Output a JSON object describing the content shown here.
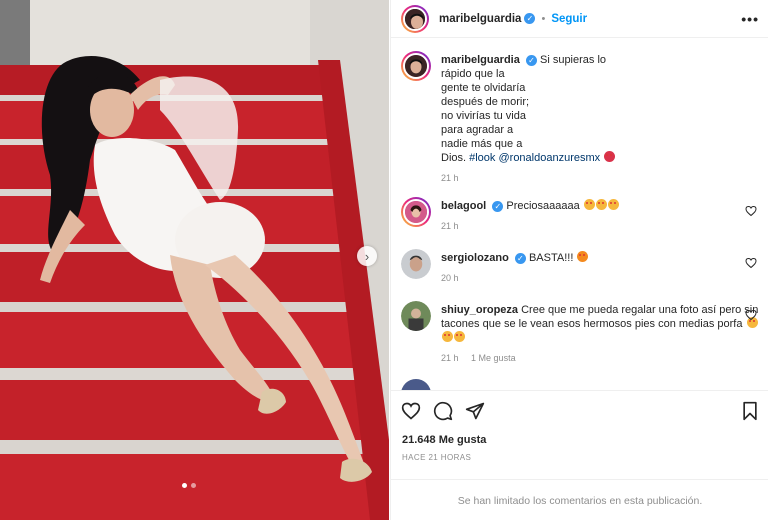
{
  "header": {
    "username": "maribelguardia",
    "follow_label": "Seguir",
    "separator": "•",
    "more_label": "•••"
  },
  "caption": {
    "username": "maribelguardia",
    "line1": "Si supieras lo",
    "line2": "rápido que la",
    "line3": "gente te olvidaría",
    "line4": "después de morir;",
    "line5": "no vivirías tu vida",
    "line6": "para agradar a",
    "line7": "nadie más que a",
    "line8": "Dios.",
    "hashtag": "#look",
    "mention": "@ronaldoanzuresmx",
    "time": "21 h"
  },
  "comments": [
    {
      "username": "belagool",
      "text": "Preciosaaaaaa",
      "time": "21 h",
      "likes": ""
    },
    {
      "username": "sergiolozano",
      "text": "BASTA!!!",
      "time": "20 h",
      "likes": ""
    },
    {
      "username": "shiuy_oropeza",
      "text": "Cree que me pueda regalar una foto así pero sin tacones que se le vean esos hermosos pies con medias porfa",
      "time": "21 h",
      "likes": "1 Me gusta"
    }
  ],
  "actions": {
    "likes_count": "21.648 Me gusta",
    "timestamp": "HACE 21 HORAS",
    "comments_limited": "Se han limitado los comentarios en esta publicación."
  },
  "icons": {
    "like": "heart-icon",
    "comment": "comment-icon",
    "share": "share-icon",
    "save": "bookmark-icon",
    "next": "chevron-right-icon"
  },
  "colors": {
    "accent": "#0095f6",
    "verified": "#3897f0",
    "stairs_red": "#c8232c",
    "muted": "#8e8e8e"
  }
}
